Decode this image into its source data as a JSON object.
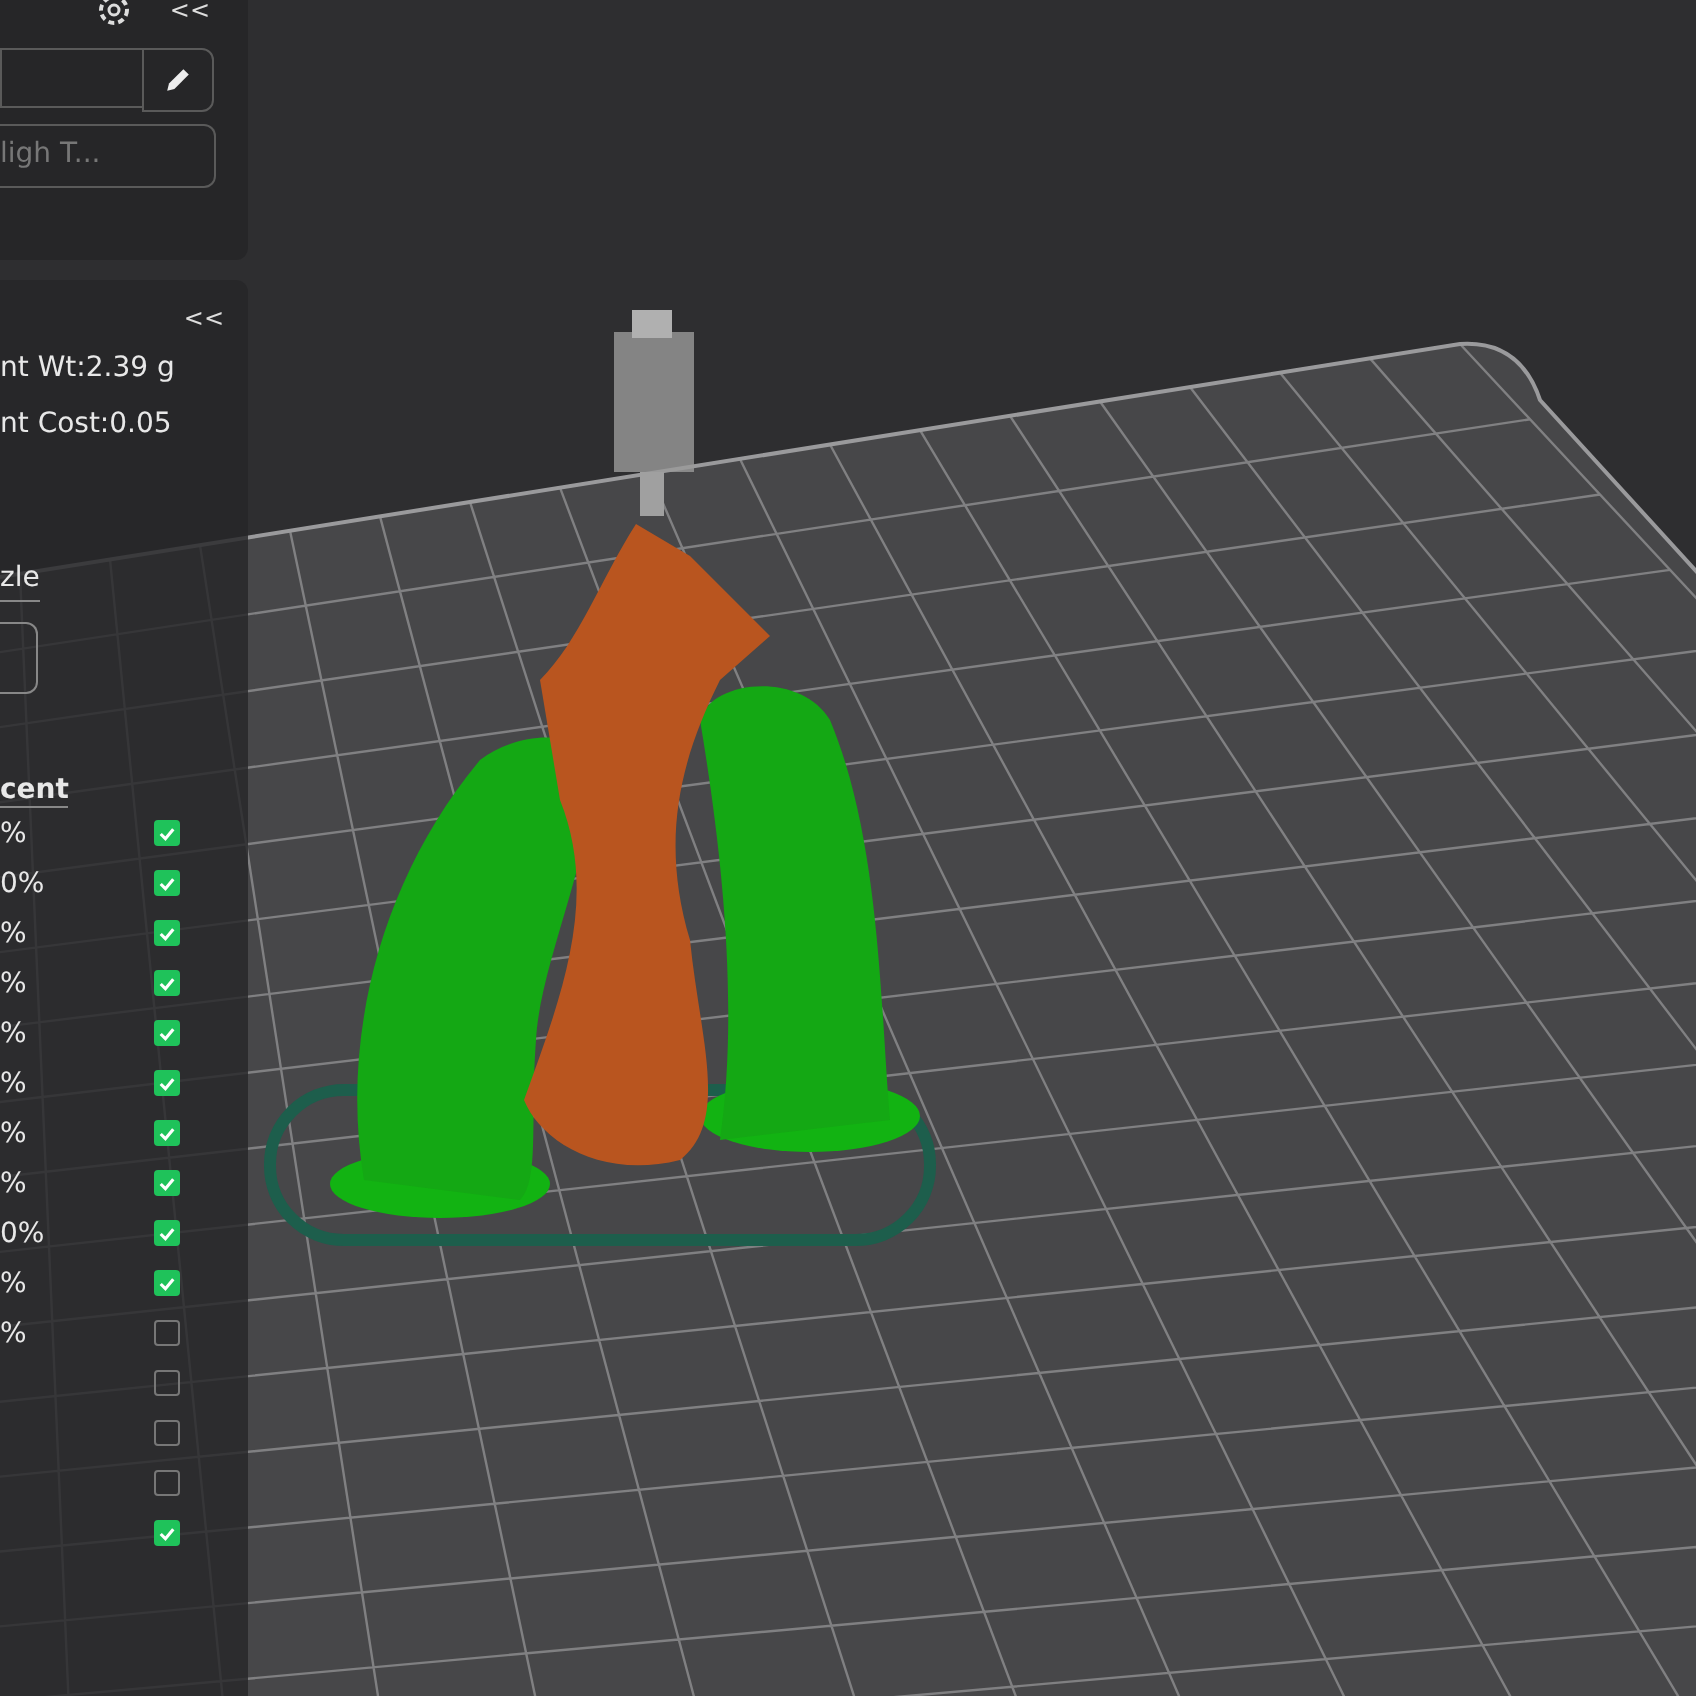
{
  "top_panel": {
    "collapse": "<<",
    "profile_field": "ligh T..."
  },
  "stats_panel": {
    "collapse": "<<",
    "weight": "nt Wt:2.39 g",
    "cost": "nt Cost:0.05",
    "section": "zle",
    "column_header": "cent",
    "rows": [
      {
        "text": "%",
        "checked": true
      },
      {
        "text": "0%",
        "checked": true
      },
      {
        "text": "%",
        "checked": true
      },
      {
        "text": "%",
        "checked": true
      },
      {
        "text": "%",
        "checked": true
      },
      {
        "text": "%",
        "checked": true
      },
      {
        "text": "%",
        "checked": true
      },
      {
        "text": "%",
        "checked": true
      },
      {
        "text": "0%",
        "checked": true
      },
      {
        "text": "%",
        "checked": true
      },
      {
        "text": "%",
        "checked": false
      },
      {
        "checked": false
      },
      {
        "checked": false
      },
      {
        "checked": false
      },
      {
        "checked": true
      }
    ]
  }
}
